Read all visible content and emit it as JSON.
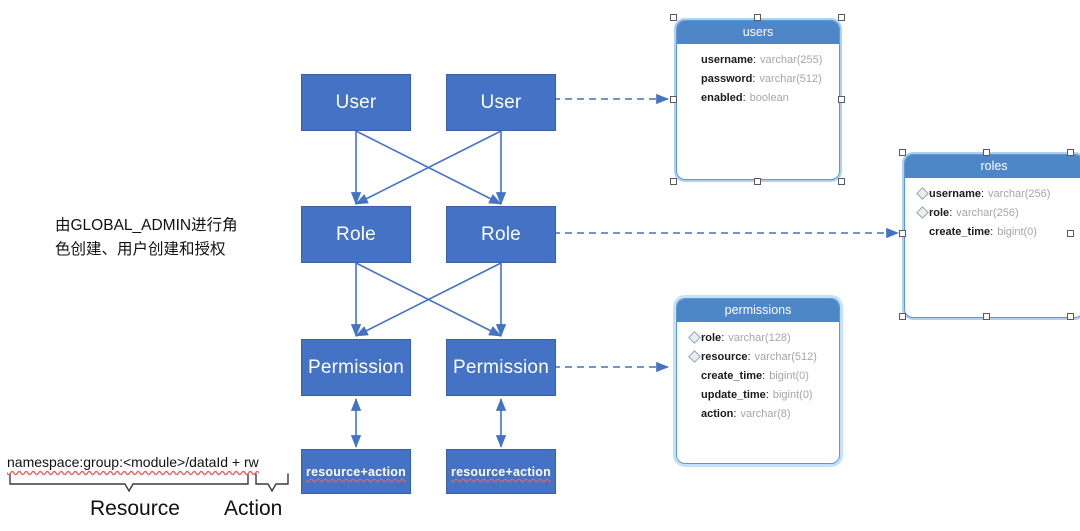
{
  "diagram": {
    "title_note": "由GLOBAL_ADMIN进行角色创建、用户创建和授权",
    "colors": {
      "box_fill": "#4472C4",
      "box_text": "#ffffff",
      "table_header": "#4E87C7",
      "table_border": "#5B9BD5",
      "connector": "#4472C4",
      "spellcheck_underline": "#e06666"
    }
  },
  "flow_nodes": [
    {
      "id": "user-left",
      "label": "User"
    },
    {
      "id": "user-right",
      "label": "User"
    },
    {
      "id": "role-left",
      "label": "Role"
    },
    {
      "id": "role-right",
      "label": "Role"
    },
    {
      "id": "permission-left",
      "label": "Permission"
    },
    {
      "id": "permission-right",
      "label": "Permission"
    },
    {
      "id": "resource-action-left",
      "label": "resource+action"
    },
    {
      "id": "resource-action-right",
      "label": "resource+action"
    }
  ],
  "tables": [
    {
      "id": "users",
      "name": "users",
      "state": "selected",
      "fields": [
        {
          "key": false,
          "name": "username",
          "type": "varchar(255)"
        },
        {
          "key": false,
          "name": "password",
          "type": "varchar(512)"
        },
        {
          "key": false,
          "name": "enabled",
          "type": "boolean"
        }
      ]
    },
    {
      "id": "roles",
      "name": "roles",
      "state": "selected",
      "fields": [
        {
          "key": true,
          "name": "username",
          "type": "varchar(256)"
        },
        {
          "key": true,
          "name": "role",
          "type": "varchar(256)"
        },
        {
          "key": false,
          "name": "create_time",
          "type": "bigint(0)"
        }
      ]
    },
    {
      "id": "permissions",
      "name": "permissions",
      "state": "highlight",
      "fields": [
        {
          "key": true,
          "name": "role",
          "type": "varchar(128)"
        },
        {
          "key": true,
          "name": "resource",
          "type": "varchar(512)"
        },
        {
          "key": false,
          "name": "create_time",
          "type": "bigint(0)"
        },
        {
          "key": false,
          "name": "update_time",
          "type": "bigint(0)"
        },
        {
          "key": false,
          "name": "action",
          "type": "varchar(8)"
        }
      ]
    }
  ],
  "annotations": {
    "admin_note": "由GLOBAL_ADMIN进行角\n色创建、用户创建和授权",
    "resource_pattern": "namespace:group:<module>/dataId + rw",
    "brace_resource_label": "Resource",
    "brace_action_label": "Action"
  }
}
